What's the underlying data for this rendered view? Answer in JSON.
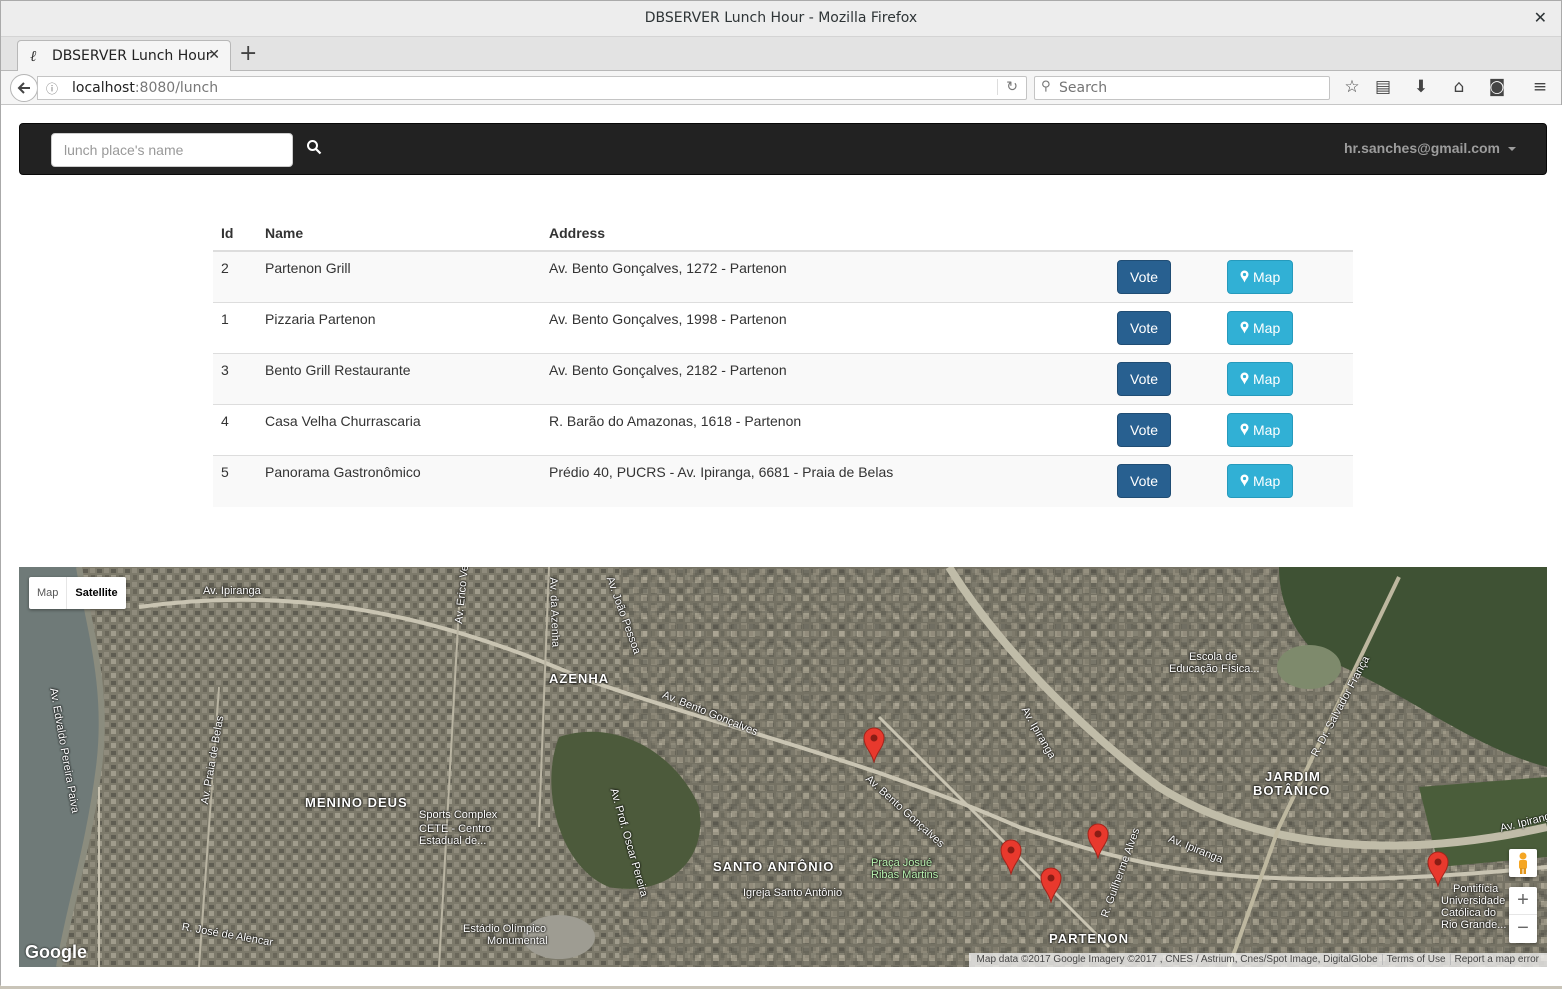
{
  "window": {
    "title": "DBSERVER Lunch Hour - Mozilla Firefox",
    "close_glyph": "✕"
  },
  "tabs": [
    {
      "favicon": "ℓ",
      "title": "DBSERVER Lunch Hour",
      "close": "✕"
    }
  ],
  "newtab_glyph": "+",
  "urlbar": {
    "info_glyph": "ⓘ",
    "host": "localhost",
    "path": ":8080/lunch",
    "reload_glyph": "↻"
  },
  "searchbar": {
    "placeholder": "Search",
    "icon": "⚲"
  },
  "toolbar_icons": [
    {
      "name": "bookmark-star-icon",
      "glyph": "☆"
    },
    {
      "name": "library-icon",
      "glyph": "▤"
    },
    {
      "name": "downloads-icon",
      "glyph": "⬇"
    },
    {
      "name": "home-icon",
      "glyph": "⌂"
    },
    {
      "name": "pocket-icon",
      "glyph": "◙"
    },
    {
      "name": "hamburger-menu-icon",
      "glyph": "≡"
    }
  ],
  "app": {
    "search_placeholder": "lunch place's name",
    "user_email": "hr.sanches@gmail.com",
    "navbar_color": "#222222"
  },
  "table": {
    "headers": {
      "id": "Id",
      "name": "Name",
      "address": "Address"
    },
    "vote_label": "Vote",
    "map_label": "Map",
    "rows": [
      {
        "id": "2",
        "name": "Partenon Grill",
        "address": "Av. Bento Gonçalves, 1272 - Partenon"
      },
      {
        "id": "1",
        "name": "Pizzaria Partenon",
        "address": "Av. Bento Gonçalves, 1998 - Partenon"
      },
      {
        "id": "3",
        "name": "Bento Grill Restaurante",
        "address": "Av. Bento Gonçalves, 2182 - Partenon"
      },
      {
        "id": "4",
        "name": "Casa Velha Churrascaria",
        "address": "R. Barão do Amazonas, 1618 - Partenon"
      },
      {
        "id": "5",
        "name": "Panorama Gastronômico",
        "address": "Prédio 40, PUCRS - Av. Ipiranga, 6681 - Praia de Belas"
      }
    ],
    "colors": {
      "vote": "#286090",
      "map": "#31b0d5"
    }
  },
  "map": {
    "type_buttons": {
      "map": "Map",
      "satellite": "Satellite"
    },
    "active_type": "Satellite",
    "labels": {
      "ipiranga_1": "Av. Ipiranga",
      "edvaldo": "Av. Edvaldo Pereira Paiva",
      "azenha_street": "Av. da Azenha",
      "joao_pessoa": "Av. João Pessoa",
      "erico": "Av. Erico Verissimo",
      "azenha": "AZENHA",
      "bento_1": "Av. Bento Gonçalves",
      "praia_belas": "Av. Praia de Belas",
      "menino_deus": "MENINO DEUS",
      "sports_complex": "Sports Complex",
      "cete": "CETE - Centro",
      "estadual": "Estadual de...",
      "oscar": "Av. Prof. Oscar Pereira",
      "santo_antonio": "SANTO ANTÔNIO",
      "praca": "Praça Josué",
      "ribas": "Ribas Martins",
      "igreja": "Igreja Santo Antônio",
      "estadio": "Estádio Olímpico",
      "monumental": "Monumental",
      "jose_alencar": "R. José de Alencar",
      "ipiranga_2": "Av. Ipiranga",
      "bento_2": "Av. Bento Gonçalves",
      "escola": "Escola de",
      "educacao": "Educação Física...",
      "jardim": "JARDIM",
      "botanico": "BOTÂNICO",
      "salvador": "R. Dr. Salvador França",
      "ipiranga_3": "Av. Ipiranga",
      "guilherme": "R. Guilherme Alves",
      "partenon": "PARTENON",
      "pucrs_1": "Pontifícia",
      "pucrs_2": "Universidade",
      "pucrs_3": "Católica do",
      "pucrs_4": "Rio Grande...",
      "ipiranga_4": "Av. Ipiranga"
    },
    "zoom_in": "+",
    "zoom_out": "−",
    "logo": "Google",
    "attribution": {
      "data": "Map data ©2017 Google Imagery ©2017 , CNES / Astrium, Cnes/Spot Image, DigitalGlobe",
      "terms": "Terms of Use",
      "report": "Report a map error"
    },
    "pin_color": "#e8392d"
  }
}
